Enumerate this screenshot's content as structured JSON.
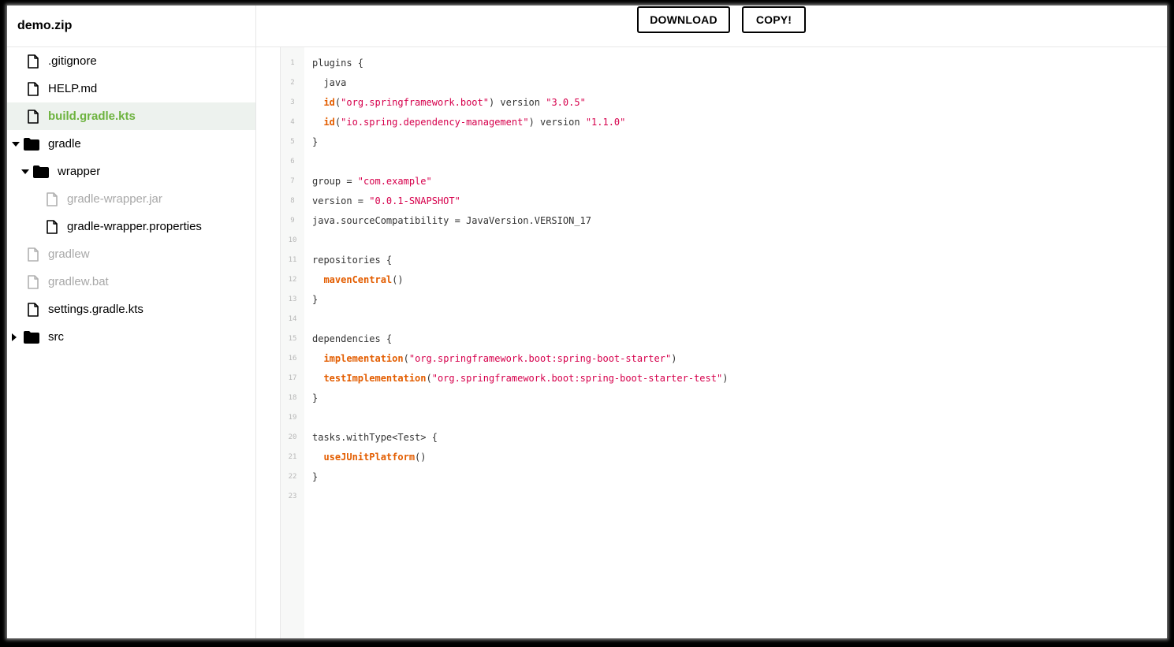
{
  "project": {
    "name": "demo.zip"
  },
  "toolbar": {
    "download_label": "DOWNLOAD",
    "copy_label": "COPY!"
  },
  "tree": [
    {
      "label": ".gitignore",
      "kind": "file",
      "depth": 0,
      "state": "normal"
    },
    {
      "label": "HELP.md",
      "kind": "file",
      "depth": 0,
      "state": "normal"
    },
    {
      "label": "build.gradle.kts",
      "kind": "file",
      "depth": 0,
      "state": "selected"
    },
    {
      "label": "gradle",
      "kind": "folder",
      "depth": 0,
      "state": "expanded"
    },
    {
      "label": "wrapper",
      "kind": "folder",
      "depth": 1,
      "state": "expanded"
    },
    {
      "label": "gradle-wrapper.jar",
      "kind": "file",
      "depth": 2,
      "state": "disabled"
    },
    {
      "label": "gradle-wrapper.properties",
      "kind": "file",
      "depth": 2,
      "state": "normal"
    },
    {
      "label": "gradlew",
      "kind": "file",
      "depth": 0,
      "state": "disabled"
    },
    {
      "label": "gradlew.bat",
      "kind": "file",
      "depth": 0,
      "state": "disabled"
    },
    {
      "label": "settings.gradle.kts",
      "kind": "file",
      "depth": 0,
      "state": "normal"
    },
    {
      "label": "src",
      "kind": "folder",
      "depth": 0,
      "state": "collapsed"
    }
  ],
  "code": {
    "lines": [
      {
        "n": "1",
        "tokens": [
          [
            "p",
            "plugins {"
          ]
        ]
      },
      {
        "n": "2",
        "tokens": [
          [
            "p",
            "  java"
          ]
        ]
      },
      {
        "n": "3",
        "tokens": [
          [
            "p",
            "  "
          ],
          [
            "f",
            "id"
          ],
          [
            "p",
            "("
          ],
          [
            "s",
            "\"org.springframework.boot\""
          ],
          [
            "p",
            ") version "
          ],
          [
            "s",
            "\"3.0.5\""
          ]
        ]
      },
      {
        "n": "4",
        "tokens": [
          [
            "p",
            "  "
          ],
          [
            "f",
            "id"
          ],
          [
            "p",
            "("
          ],
          [
            "s",
            "\"io.spring.dependency-management\""
          ],
          [
            "p",
            ") version "
          ],
          [
            "s",
            "\"1.1.0\""
          ]
        ]
      },
      {
        "n": "5",
        "tokens": [
          [
            "p",
            "}"
          ]
        ]
      },
      {
        "n": "6",
        "tokens": []
      },
      {
        "n": "7",
        "tokens": [
          [
            "p",
            "group = "
          ],
          [
            "s",
            "\"com.example\""
          ]
        ]
      },
      {
        "n": "8",
        "tokens": [
          [
            "p",
            "version = "
          ],
          [
            "s",
            "\"0.0.1-SNAPSHOT\""
          ]
        ]
      },
      {
        "n": "9",
        "tokens": [
          [
            "p",
            "java.sourceCompatibility = JavaVersion.VERSION_17"
          ]
        ]
      },
      {
        "n": "10",
        "tokens": []
      },
      {
        "n": "11",
        "tokens": [
          [
            "p",
            "repositories {"
          ]
        ]
      },
      {
        "n": "12",
        "tokens": [
          [
            "p",
            "  "
          ],
          [
            "f",
            "mavenCentral"
          ],
          [
            "p",
            "()"
          ]
        ]
      },
      {
        "n": "13",
        "tokens": [
          [
            "p",
            "}"
          ]
        ]
      },
      {
        "n": "14",
        "tokens": []
      },
      {
        "n": "15",
        "tokens": [
          [
            "p",
            "dependencies {"
          ]
        ]
      },
      {
        "n": "16",
        "tokens": [
          [
            "p",
            "  "
          ],
          [
            "f",
            "implementation"
          ],
          [
            "p",
            "("
          ],
          [
            "s",
            "\"org.springframework.boot:spring-boot-starter\""
          ],
          [
            "p",
            ")"
          ]
        ]
      },
      {
        "n": "17",
        "tokens": [
          [
            "p",
            "  "
          ],
          [
            "f",
            "testImplementation"
          ],
          [
            "p",
            "("
          ],
          [
            "s",
            "\"org.springframework.boot:spring-boot-starter-test\""
          ],
          [
            "p",
            ")"
          ]
        ]
      },
      {
        "n": "18",
        "tokens": [
          [
            "p",
            "}"
          ]
        ]
      },
      {
        "n": "19",
        "tokens": []
      },
      {
        "n": "20",
        "tokens": [
          [
            "p",
            "tasks.withType<Test> {"
          ]
        ]
      },
      {
        "n": "21",
        "tokens": [
          [
            "p",
            "  "
          ],
          [
            "f",
            "useJUnitPlatform"
          ],
          [
            "p",
            "()"
          ]
        ]
      },
      {
        "n": "22",
        "tokens": [
          [
            "p",
            "}"
          ]
        ]
      },
      {
        "n": "23",
        "tokens": []
      }
    ]
  },
  "colors": {
    "selected": "#6db33f",
    "function": "#e35d00",
    "string": "#d6004c",
    "disabled": "#a8a8a8"
  }
}
